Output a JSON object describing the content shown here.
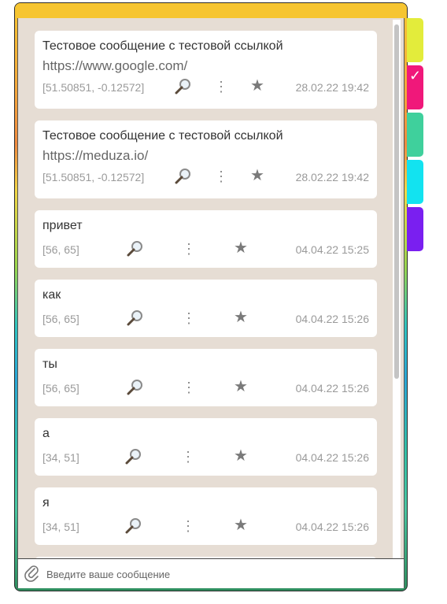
{
  "messages": [
    {
      "text": "Тестовое сообщение с тестовой ссылкой",
      "link": "https://www.google.com/",
      "coords": "[51.50851, -0.12572]",
      "date": "28.02.22 19:42"
    },
    {
      "text": "Тестовое сообщение с тестовой ссылкой",
      "link": "https://meduza.io/",
      "coords": "[51.50851, -0.12572]",
      "date": "28.02.22 19:42"
    },
    {
      "text": "привет",
      "coords": "[56, 65]",
      "date": "04.04.22 15:25"
    },
    {
      "text": "как",
      "coords": "[56, 65]",
      "date": "04.04.22 15:26"
    },
    {
      "text": "ты",
      "coords": "[56, 65]",
      "date": "04.04.22 15:26"
    },
    {
      "text": "а",
      "coords": "[34, 51]",
      "date": "04.04.22 15:26"
    },
    {
      "text": "я",
      "coords": "[34, 51]",
      "date": "04.04.22 15:26"
    }
  ],
  "icons": {
    "search": "magnifier-icon",
    "menu": "more-vertical-icon",
    "star": "star-icon",
    "attach": "paperclip-icon",
    "check": "check-icon"
  },
  "composer": {
    "placeholder": "Введите ваше сообщение"
  },
  "tabs": [
    {
      "color": "#e3ec3b",
      "selected": false
    },
    {
      "color": "#f0187a",
      "selected": true
    },
    {
      "color": "#3fd09c",
      "selected": false
    },
    {
      "color": "#12e3f0",
      "selected": false
    },
    {
      "color": "#7a1ff0",
      "selected": false
    }
  ],
  "frame": {
    "accent": "#f6c531"
  }
}
